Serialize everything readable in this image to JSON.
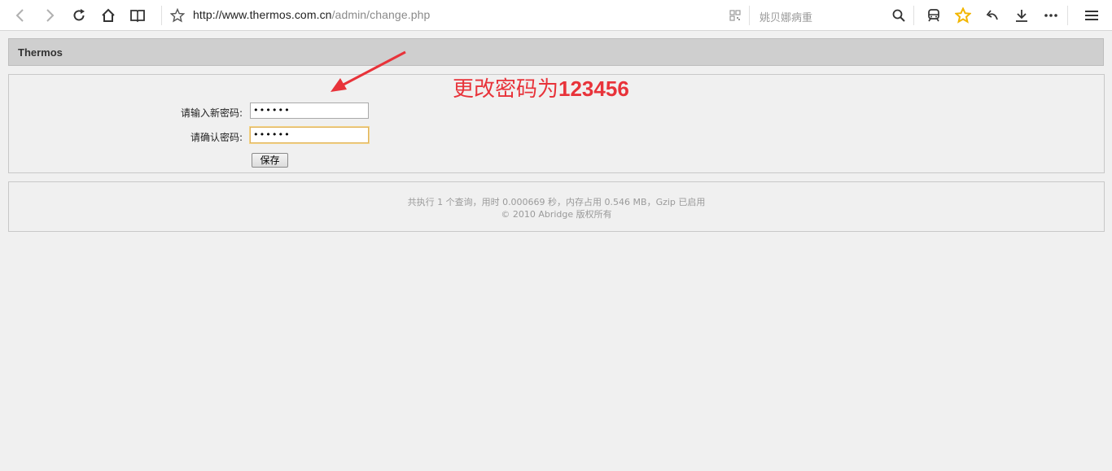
{
  "browser": {
    "url_host": "http://www.thermos.com.cn",
    "url_path": "/admin/change.php",
    "search_text": "姚贝娜病重",
    "star_color": "#f2b600"
  },
  "page": {
    "header_title": "Thermos",
    "form": {
      "new_password_label": "请输入新密码:",
      "new_password_value": "••••••",
      "confirm_password_label": "请确认密码:",
      "confirm_password_value": "••••••",
      "save_label": "保存"
    },
    "annotation": {
      "text_prefix": "更改密码为",
      "text_number": "123456",
      "color": "#e8333a"
    },
    "footer": {
      "line1": "共执行 1 个查询，用时 0.000669 秒，内存占用 0.546 MB，Gzip 已启用",
      "line2": "© 2010 Abridge 版权所有"
    }
  }
}
